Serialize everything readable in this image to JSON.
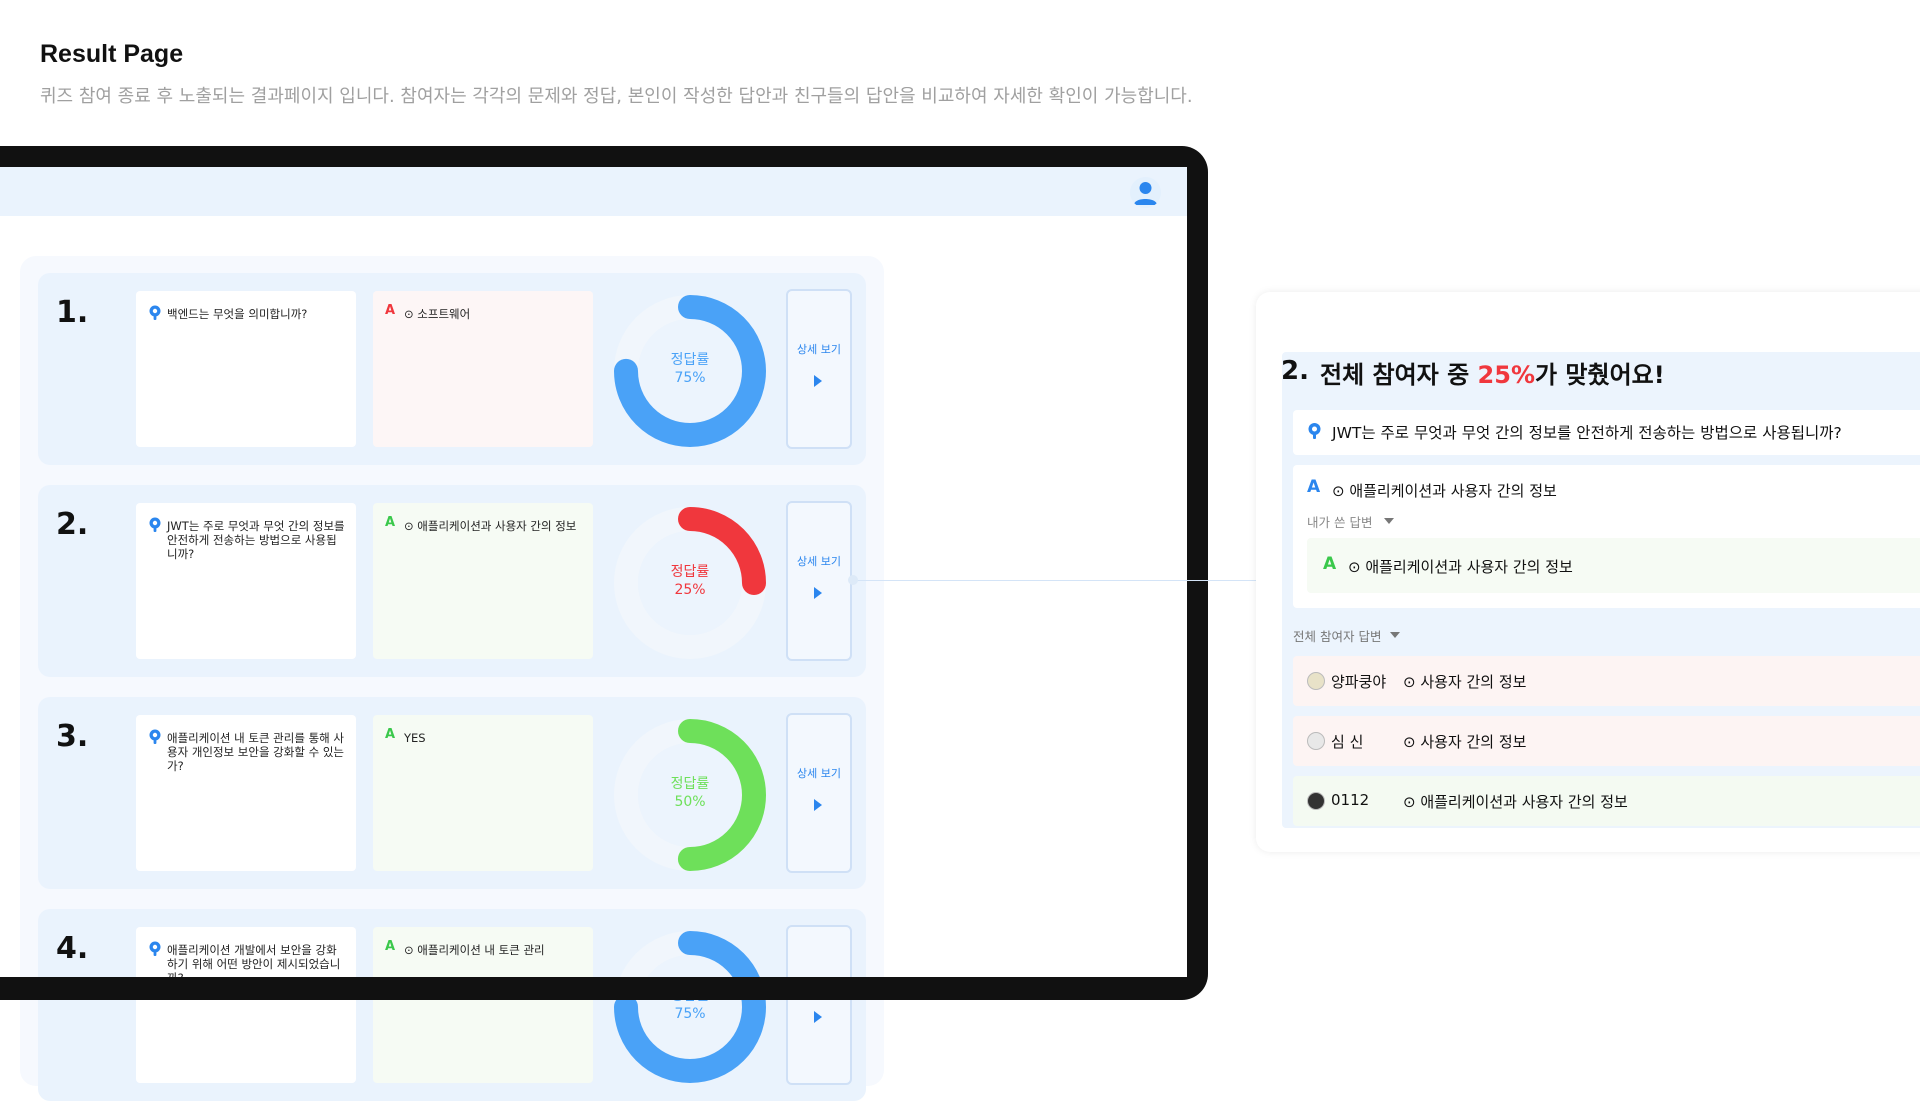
{
  "header": {
    "title": "Result Page",
    "description": "퀴즈 참여 종료 후 노출되는 결과페이지 입니다. 참여자는 각각의 문제와 정답, 본인이 작성한 답안과 친구들의 답안을 비교하여 자세한 확인이 가능합니다."
  },
  "colors": {
    "accent_blue": "#2b86ee",
    "donut_blue": "#4aa2f7",
    "wrong_red": "#f0373d",
    "right_green": "#6ee05a",
    "panel_bg": "#eaf3fd"
  },
  "rows": [
    {
      "num": "1.",
      "question": "백엔드는 무엇을 의미합니까?",
      "answer": "⊙ 소프트웨어",
      "answer_state": "wrong",
      "rate_label": "정답률",
      "rate_text": "75%",
      "rate": 0.75,
      "donut_color": "#4aa2f7",
      "detail": "상세 보기"
    },
    {
      "num": "2.",
      "question": "JWT는 주로 무엇과 무엇 간의 정보를 안전하게 전송하는 방법으로 사용됩니까?",
      "answer": "⊙ 애플리케이션과 사용자 간의 정보",
      "answer_state": "right",
      "rate_label": "정답률",
      "rate_text": "25%",
      "rate": 0.25,
      "donut_color": "#f0373d",
      "detail": "상세 보기"
    },
    {
      "num": "3.",
      "question": "애플리케이션 내 토큰 관리를 통해 사용자 개인정보 보안을 강화할 수 있는가?",
      "answer": "YES",
      "answer_state": "right",
      "rate_label": "정답률",
      "rate_text": "50%",
      "rate": 0.5,
      "donut_color": "#6ee05a",
      "detail": "상세 보기"
    },
    {
      "num": "4.",
      "question": "애플리케이션 개발에서 보안을 강화하기 위해 어떤 방안이 제시되었습니까?",
      "answer": "⊙ 애플리케이션 내 토큰 관리",
      "answer_state": "right",
      "rate_label": "정답률",
      "rate_text": "75%",
      "rate": 0.75,
      "donut_color": "#4aa2f7",
      "detail": ""
    }
  ],
  "detail": {
    "num": "2.",
    "title_pre": "전체 참여자 중 ",
    "title_pct": "25%",
    "title_post": "가 맞췄어요!",
    "question": "JWT는 주로 무엇과 무엇 간의 정보를 안전하게 전송하는 방법으로 사용됩니까?",
    "answer": "⊙ 애플리케이션과 사용자 간의 정보",
    "my_answer_label": "내가 쓴 답변",
    "my_answer": "⊙ 애플리케이션과 사용자 간의 정보",
    "all_label": "전체 참여자 답변",
    "participants": [
      {
        "name": "양파쿵야",
        "answer": "⊙ 사용자 간의 정보",
        "state": "wrong"
      },
      {
        "name": "심 신",
        "answer": "⊙ 사용자 간의 정보",
        "state": "wrong"
      },
      {
        "name": "0112",
        "answer": "⊙ 애플리케이션과 사용자 간의 정보",
        "state": "right"
      }
    ]
  }
}
